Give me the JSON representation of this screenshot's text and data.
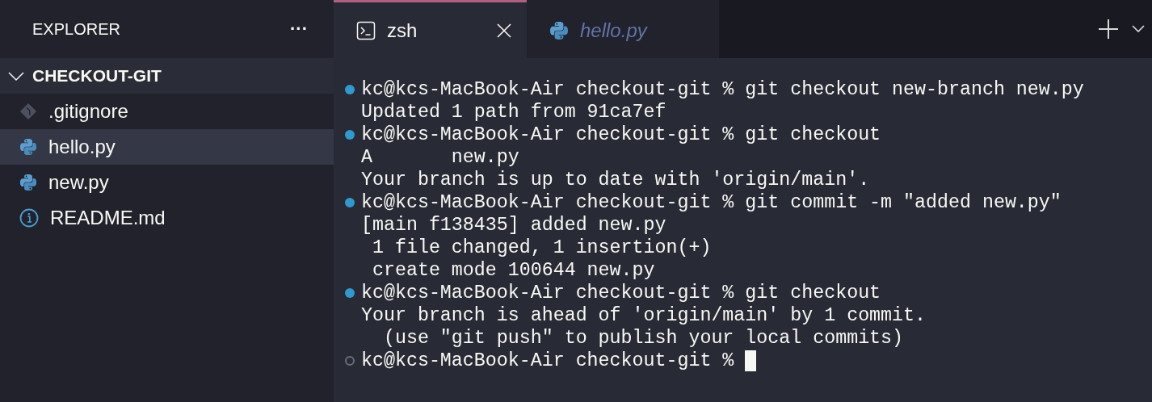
{
  "sidebar": {
    "title": "EXPLORER",
    "more_button": "···",
    "folder": {
      "name": "CHECKOUT-GIT",
      "expanded": true,
      "children": [
        {
          "name": ".gitignore",
          "kind": "git",
          "selected": false
        },
        {
          "name": "hello.py",
          "kind": "python",
          "selected": true
        },
        {
          "name": "new.py",
          "kind": "python",
          "selected": false
        },
        {
          "name": "README.md",
          "kind": "info",
          "selected": false
        }
      ]
    }
  },
  "tabs": [
    {
      "label": "zsh",
      "kind": "terminal",
      "selected": true,
      "preview": false
    },
    {
      "label": "hello.py",
      "kind": "python",
      "selected": false,
      "preview": true
    }
  ],
  "terminal": {
    "lines": [
      {
        "kind": "prompt",
        "finished": true,
        "text": "kc@kcs-MacBook-Air checkout-git % git checkout new-branch new.py"
      },
      {
        "kind": "output",
        "text": "Updated 1 path from 91ca7ef"
      },
      {
        "kind": "prompt",
        "finished": true,
        "text": "kc@kcs-MacBook-Air checkout-git % git checkout"
      },
      {
        "kind": "output",
        "text": "A       new.py"
      },
      {
        "kind": "output",
        "text": "Your branch is up to date with 'origin/main'."
      },
      {
        "kind": "prompt",
        "finished": true,
        "text": "kc@kcs-MacBook-Air checkout-git % git commit -m \"added new.py\""
      },
      {
        "kind": "output",
        "text": "[main f138435] added new.py"
      },
      {
        "kind": "output",
        "text": " 1 file changed, 1 insertion(+)"
      },
      {
        "kind": "output",
        "text": " create mode 100644 new.py"
      },
      {
        "kind": "prompt",
        "finished": true,
        "text": "kc@kcs-MacBook-Air checkout-git % git checkout"
      },
      {
        "kind": "output",
        "text": "Your branch is ahead of 'origin/main' by 1 commit."
      },
      {
        "kind": "output",
        "text": "  (use \"git push\" to publish your local commits)"
      },
      {
        "kind": "prompt",
        "finished": false,
        "cursor": true,
        "text": "kc@kcs-MacBook-Air checkout-git %"
      }
    ]
  }
}
